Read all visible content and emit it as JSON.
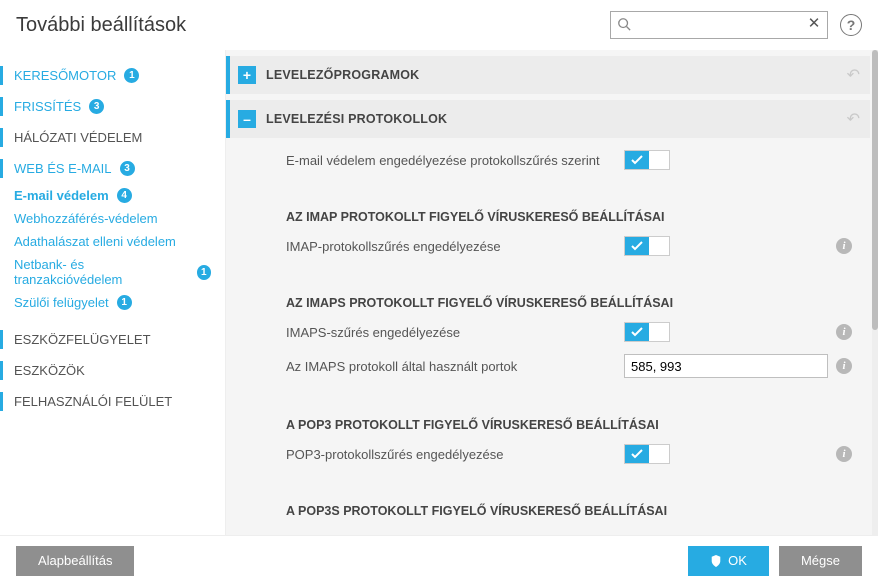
{
  "title": "További beállítások",
  "search": {
    "placeholder": ""
  },
  "sidebar": {
    "items": [
      {
        "label": "KERESŐMOTOR",
        "badge": "1"
      },
      {
        "label": "FRISSÍTÉS",
        "badge": "3"
      },
      {
        "label": "HÁLÓZATI VÉDELEM",
        "badge": ""
      },
      {
        "label": "WEB ÉS E-MAIL",
        "badge": "3"
      },
      {
        "label": "E-mail védelem",
        "badge": "4"
      },
      {
        "label": "Webhozzáférés-védelem",
        "badge": ""
      },
      {
        "label": "Adathalászat elleni védelem",
        "badge": ""
      },
      {
        "label": "Netbank- és tranzakcióvédelem",
        "badge": "1"
      },
      {
        "label": "Szülői felügyelet",
        "badge": "1"
      },
      {
        "label": "ESZKÖZFELÜGYELET",
        "badge": ""
      },
      {
        "label": "ESZKÖZÖK",
        "badge": ""
      },
      {
        "label": "FELHASZNÁLÓI FELÜLET",
        "badge": ""
      }
    ]
  },
  "groups": {
    "g0": {
      "title": "LEVELEZŐPROGRAMOK"
    },
    "g1": {
      "title": "LEVELEZÉSI PROTOKOLLOK"
    }
  },
  "rows": {
    "r0": {
      "label": "E-mail védelem engedélyezése protokollszűrés szerint"
    },
    "s1": "AZ IMAP PROTOKOLLT FIGYELŐ VÍRUSKERESŐ BEÁLLÍTÁSAI",
    "r1": {
      "label": "IMAP-protokollszűrés engedélyezése"
    },
    "s2": "AZ IMAPS PROTOKOLLT FIGYELŐ VÍRUSKERESŐ BEÁLLÍTÁSAI",
    "r2": {
      "label": "IMAPS-szűrés engedélyezése"
    },
    "r3": {
      "label": "Az IMAPS protokoll által használt portok",
      "value": "585, 993"
    },
    "s3": "A POP3 PROTOKOLLT FIGYELŐ VÍRUSKERESŐ BEÁLLÍTÁSAI",
    "r4": {
      "label": "POP3-protokollszűrés engedélyezése"
    },
    "s4": "A POP3S PROTOKOLLT FIGYELŐ VÍRUSKERESŐ BEÁLLÍTÁSAI"
  },
  "footer": {
    "default": "Alapbeállítás",
    "ok": "OK",
    "cancel": "Mégse"
  }
}
